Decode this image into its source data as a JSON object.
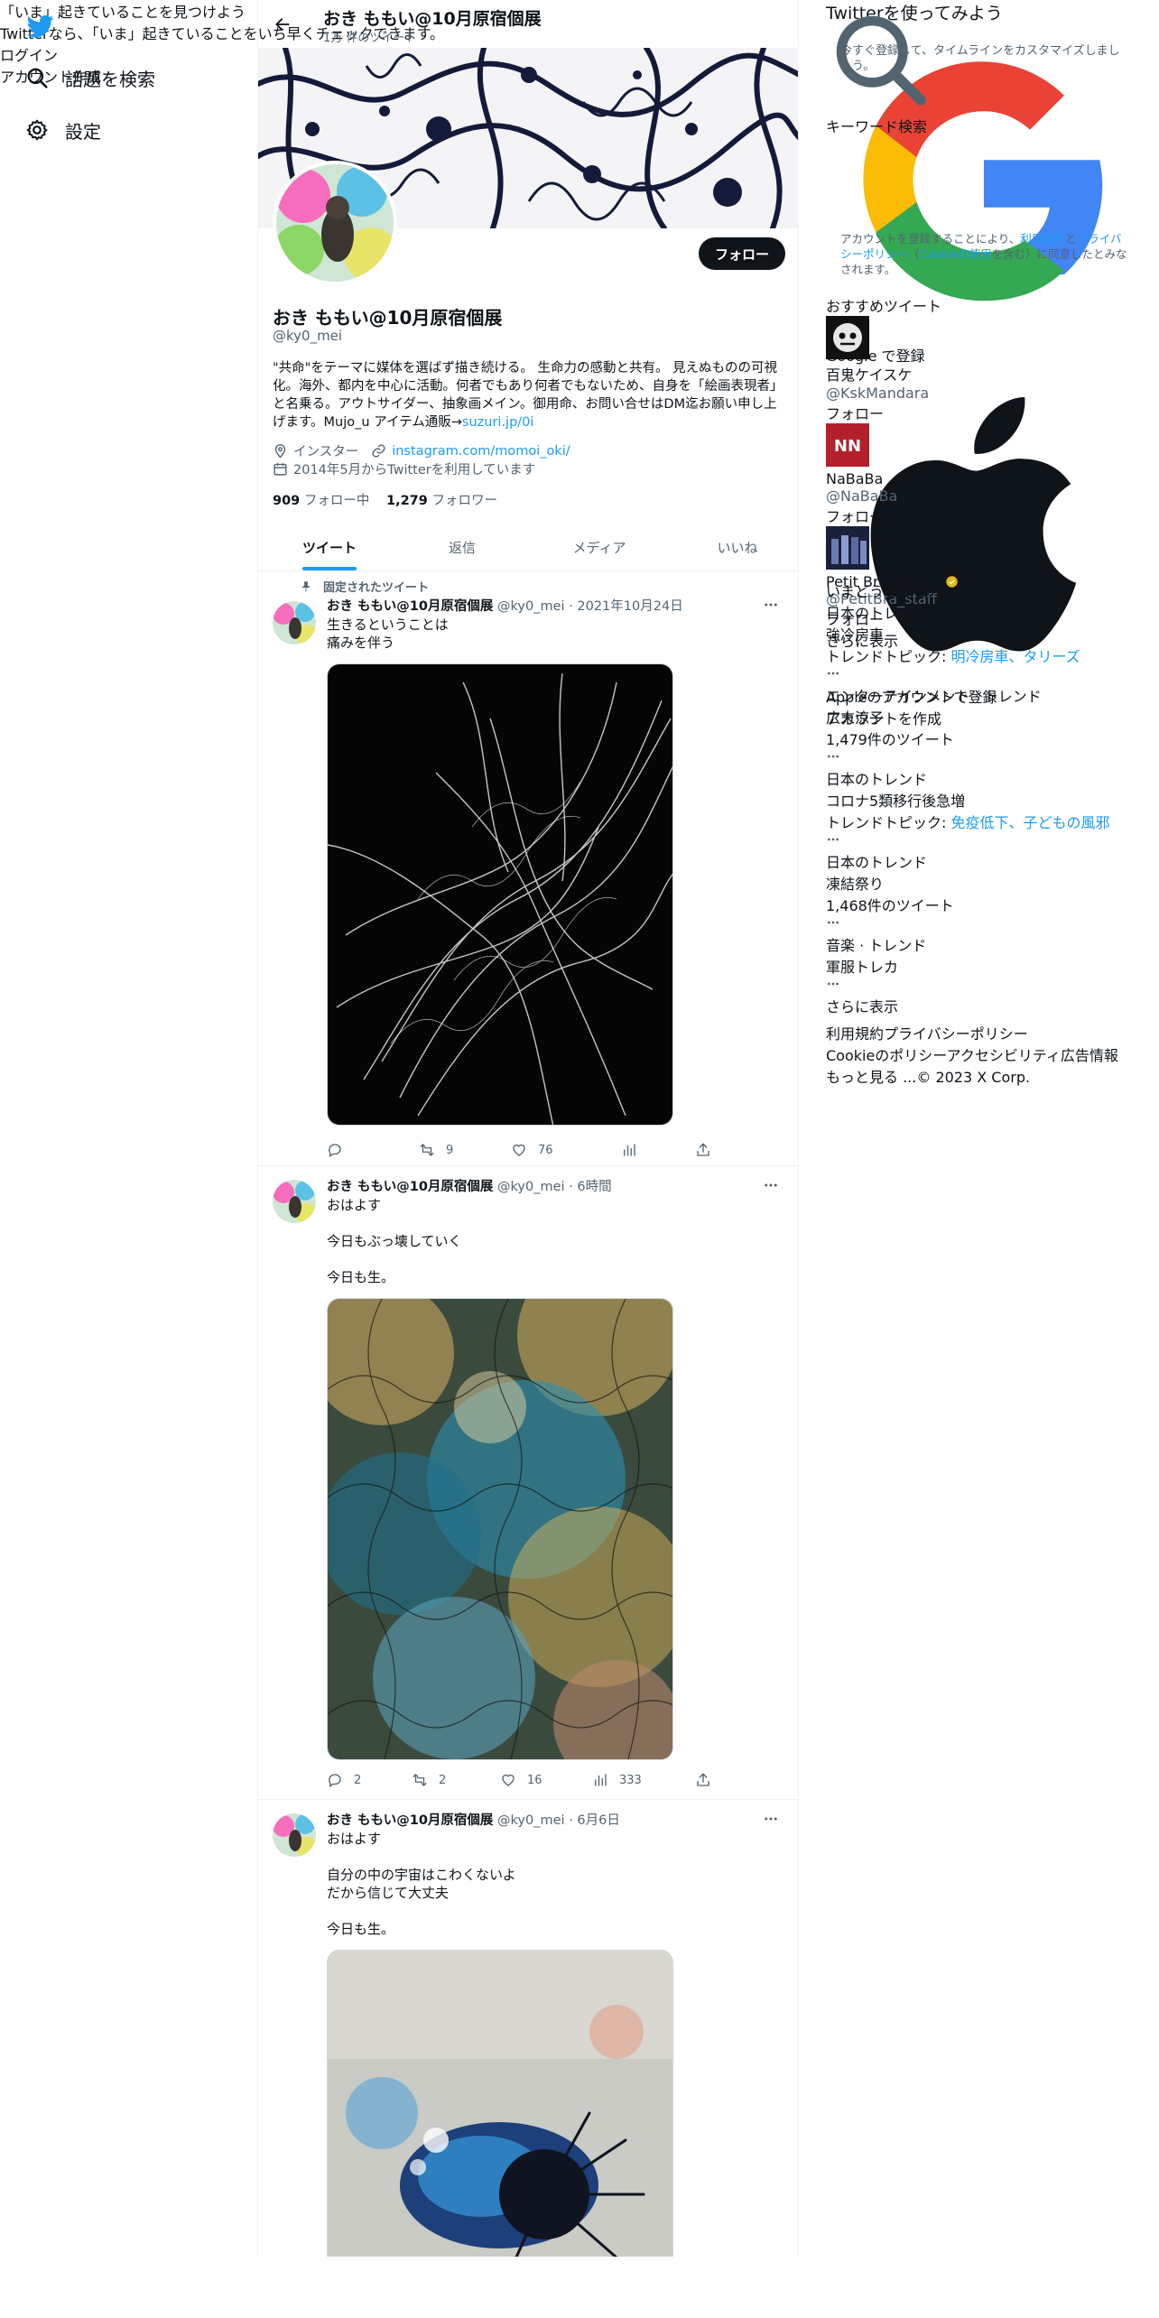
{
  "nav": {
    "explore_label": "話題を検索",
    "settings_label": "設定"
  },
  "profile": {
    "top_title": "おき ももい@10月原宿個展",
    "tweet_count": "1万 件のツイート",
    "follow_label": "フォロー",
    "name": "おき ももい@10月原宿個展",
    "handle": "@ky0_mei",
    "bio_text": "\"共命\"をテーマに媒体を選ばず描き続ける。 生命力の感動と共有。 見えぬものの可視化。海外、都内を中心に活動。何者でもあり何者でもないため、自身を「絵画表現者」と名乗る。アウトサイダー、抽象画メイン。御用命、お問い合せはDM迄お願い申し上げます。Mujo_u アイテム通販→",
    "bio_link": "suzuri.jp/0i",
    "location": "インスター",
    "website": "instagram.com/momoi_oki/",
    "joined": "2014年5月からTwitterを利用しています",
    "following_count": "909",
    "following_label": "フォロー中",
    "followers_count": "1,279",
    "followers_label": "フォロワー"
  },
  "tabs": [
    "ツイート",
    "返信",
    "メディア",
    "いいね"
  ],
  "tweets": [
    {
      "pinned_label": "固定されたツイート",
      "name": "おき ももい@10月原宿個展",
      "handle_time": "@ky0_mei · 2021年10月24日",
      "text": "生きるということは\n痛みを伴う",
      "replies": "",
      "retweets": "9",
      "likes": "76",
      "views": ""
    },
    {
      "name": "おき ももい@10月原宿個展",
      "handle_time": "@ky0_mei · 6時間",
      "text": "おはよす\n\n今日もぶっ壊していく\n\n今日も生。",
      "replies": "2",
      "retweets": "2",
      "likes": "16",
      "views": "333"
    },
    {
      "name": "おき ももい@10月原宿個展",
      "handle_time": "@ky0_mei · 6月6日",
      "text": "おはよす\n\n自分の中の宇宙はこわくないよ\nだから信じて大丈夫\n\n今日も生。"
    }
  ],
  "search": {
    "placeholder": "キーワード検索"
  },
  "signup_card": {
    "title": "Twitterを使ってみよう",
    "subtitle": "今すぐ登録して、タイムラインをカスタマイズしましょう。",
    "google": "Google で登録",
    "apple": "Appleのアカウントで登録",
    "create": "アカウントを作成",
    "legal_1": "アカウントを登録することにより、",
    "legal_terms": "利用規約",
    "legal_2": "と",
    "legal_privacy": "プライバシーポリシー",
    "legal_3": "（",
    "legal_cookie": "Cookieの使用",
    "legal_4": "を含む）に同意したとみなされます。"
  },
  "who_to_follow": {
    "title": "おすすめツイート",
    "users": [
      {
        "name": "百鬼ケイスケ",
        "handle": "@KskMandara",
        "button": "フォロー"
      },
      {
        "name": "NaBaBa",
        "handle": "@NaBaBa",
        "button": "フォロー"
      },
      {
        "name": "Petit Brabancon",
        "handle": "@PetitBra_staff",
        "button": "フォロー"
      }
    ],
    "show_more": "さらに表示"
  },
  "trends": {
    "title": "いまどうしてる？",
    "items": [
      {
        "context": "日本のトレンド",
        "name": "強冷房車",
        "sub_prefix": "トレンドトピック: ",
        "sub_links": "明冷房車、タリーズ"
      },
      {
        "context": "エンターテインメント · トレンド",
        "name": "広末涼子",
        "sub": "1,479件のツイート"
      },
      {
        "context": "日本のトレンド",
        "name": "コロナ5類移行後急増",
        "sub_prefix": "トレンドトピック: ",
        "sub_links": "免疫低下、子どもの風邪"
      },
      {
        "context": "日本のトレンド",
        "name": "凍結祭り",
        "sub": "1,468件のツイート"
      },
      {
        "context": "音楽 · トレンド",
        "name": "軍服トレカ"
      }
    ],
    "show_more": "さらに表示"
  },
  "footer": {
    "terms": "利用規約",
    "privacy": "プライバシーポリシー",
    "cookie": "Cookieのポリシー",
    "accessibility": "アクセシビリティ",
    "ads": "広告情報",
    "more": "もっと見る ...",
    "copyright": "© 2023 X Corp."
  },
  "bottom_bar": {
    "title": "「いま」起きていることを見つけよう",
    "subtitle": "Twitterなら、「いま」起きていることをいち早くチェックできます。",
    "login": "ログイン",
    "signup": "アカウント作成"
  },
  "colors": {
    "accent": "#1d9bf0",
    "text": "#0f1419",
    "muted": "#536471",
    "border": "#eff3f4"
  }
}
